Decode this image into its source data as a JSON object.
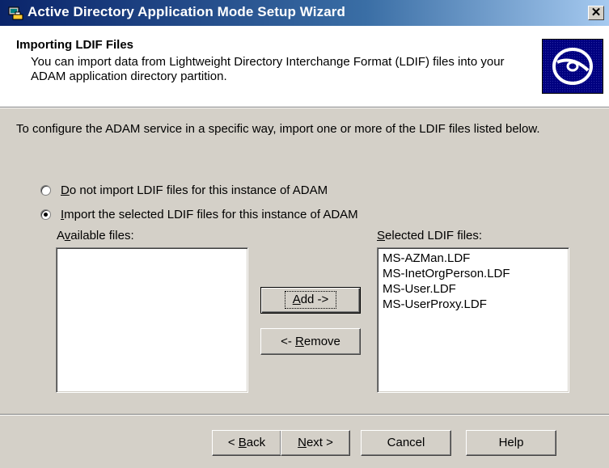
{
  "window": {
    "title": "Active Directory Application Mode Setup Wizard",
    "close_glyph": "✕"
  },
  "header": {
    "title": "Importing LDIF Files",
    "description": "You can import data from Lightweight Directory Interchange Format (LDIF) files into your ADAM application directory partition."
  },
  "intro": "To configure the ADAM service in a specific way, import one or more of the LDIF files listed below.",
  "options": {
    "no_import": {
      "pre": "",
      "mnemonic": "D",
      "post": "o not import LDIF files for this instance of ADAM",
      "checked": false
    },
    "import": {
      "pre": "",
      "mnemonic": "I",
      "post": "mport the selected LDIF files for this instance of ADAM",
      "checked": true
    }
  },
  "available": {
    "label_pre": "A",
    "label_mnemonic": "v",
    "label_post": "ailable files:",
    "items": []
  },
  "selected": {
    "label_pre": "",
    "label_mnemonic": "S",
    "label_post": "elected LDIF files:",
    "items": [
      "MS-AZMan.LDF",
      "MS-InetOrgPerson.LDF",
      "MS-User.LDF",
      "MS-UserProxy.LDF"
    ]
  },
  "buttons": {
    "add": {
      "mnemonic": "A",
      "post": "dd ->"
    },
    "remove": {
      "pre": "<- ",
      "mnemonic": "R",
      "post": "emove"
    },
    "back": {
      "pre": "< ",
      "mnemonic": "B",
      "post": "ack"
    },
    "next": {
      "mnemonic": "N",
      "post": "ext >"
    },
    "cancel": "Cancel",
    "help": "Help"
  }
}
